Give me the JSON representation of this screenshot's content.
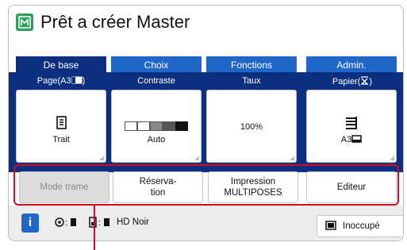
{
  "window": {
    "title": "Prêt a créer Master"
  },
  "tabs": [
    {
      "label": "De base",
      "active": true
    },
    {
      "label": "Choix",
      "active": false
    },
    {
      "label": "Fonctions",
      "active": false
    },
    {
      "label": "Admin.",
      "active": false
    }
  ],
  "settings": {
    "page": {
      "label": "Page(A3",
      "value": "Trait"
    },
    "contrast": {
      "label": "Contraste",
      "value": "Auto",
      "level_of_5": 3
    },
    "rate": {
      "label": "Taux",
      "value": "100%"
    },
    "paper": {
      "label": "Papier(",
      "close": ")",
      "value": "A3"
    }
  },
  "actions": {
    "screen_mode": "Mode trame",
    "reservation_line1": "Réserva-",
    "reservation_line2": "tion",
    "multi_line1": "Impression",
    "multi_line2": "MULTIPOSES",
    "editor": "Editeur"
  },
  "status": {
    "info": "i",
    "ink_text": "HD Noir",
    "state": "Inoccupé"
  },
  "colors": {
    "tab_active": "#0d2f80",
    "tab_inactive": "#1f66c7",
    "highlight_frame": "#d10b1f",
    "title_icon": "#2f9e5a"
  }
}
